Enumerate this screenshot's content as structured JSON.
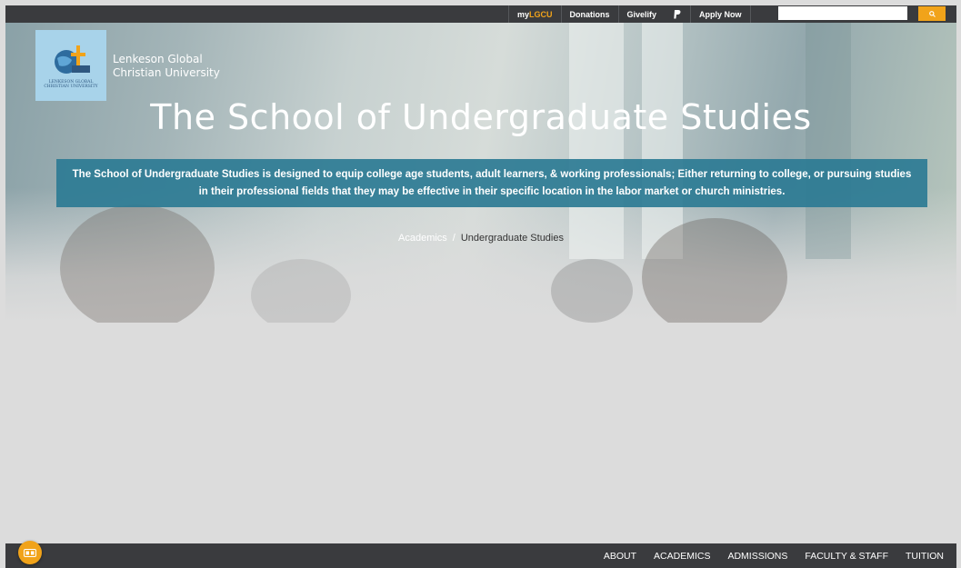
{
  "topbar": {
    "links": [
      {
        "prefix": "my",
        "accent": "LGCU",
        "name": "mylgcu-link"
      },
      {
        "label": "Donations",
        "name": "donations-link"
      },
      {
        "label": "Givelify",
        "name": "givelify-link"
      },
      {
        "icon": "paypal-icon",
        "name": "paypal-link"
      },
      {
        "label": "Apply Now",
        "name": "apply-now-link"
      }
    ],
    "search": {
      "placeholder": "",
      "value": "",
      "icon": "search-icon"
    }
  },
  "brand": {
    "logo_caption": "LENKESON GLOBAL\nCHRISTIAN UNIVERSITY",
    "name_line1": "Lenkeson Global",
    "name_line2": "Christian University"
  },
  "hero": {
    "title": "The School of Undergraduate Studies",
    "intro": "The School of Undergraduate Studies is designed to equip college age students, adult learners, & working professionals; Either returning to college, or pursuing studies in their professional fields that they may be effective in their specific location in the labor market or church ministries.",
    "breadcrumb": {
      "parent": "Academics",
      "separator": "/",
      "current": "Undergraduate Studies"
    }
  },
  "bottom_nav": {
    "items": [
      "ABOUT",
      "ACADEMICS",
      "ADMISSIONS",
      "FACULTY & STAFF",
      "TUITION"
    ]
  },
  "fab": {
    "icon": "accessibility-icon"
  },
  "colors": {
    "accent": "#f1a31a",
    "bar": "#3a3b3e",
    "intro_bg": "#2c7b94"
  }
}
